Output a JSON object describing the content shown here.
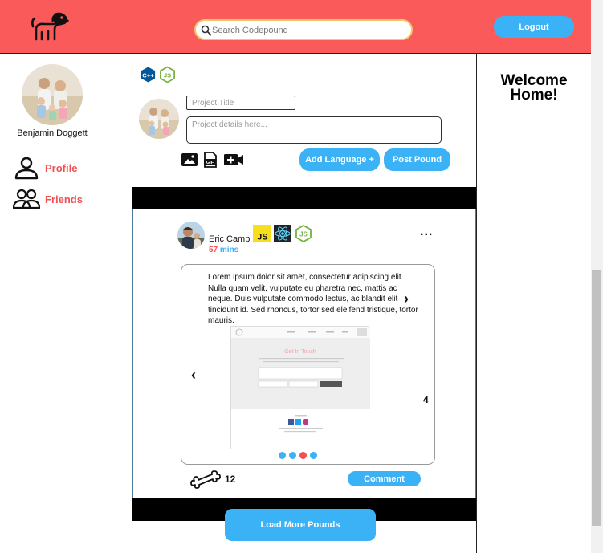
{
  "header": {
    "search_placeholder": "Search Codepound",
    "logout_label": "Logout"
  },
  "sidebar": {
    "user_name": "Benjamin Doggett",
    "items": [
      {
        "label": "Profile",
        "icon": "person-icon"
      },
      {
        "label": "Friends",
        "icon": "people-icon"
      }
    ]
  },
  "composer": {
    "languages": [
      "C++",
      "JS"
    ],
    "title_placeholder": "Project Title",
    "details_placeholder": "Project details here...",
    "media_icons": [
      "image-icon",
      "gif-icon",
      "video-plus-icon"
    ],
    "add_language_label": "Add Language +",
    "post_label": "Post Pound"
  },
  "post": {
    "author": "Eric Camp",
    "time_value": "57",
    "time_unit": "mins",
    "languages": [
      "JS",
      "React",
      "Node"
    ],
    "more_label": "...",
    "text": "Lorem ipsum dolor sit amet, consectetur adipiscing elit. Nulla quam velit, vulputate eu pharetra nec, mattis ac neque. Duis vulputate commodo lectus, ac blandit elit tincidunt id. Sed rhoncus, tortor sed eleifend tristique, tortor mauris.",
    "slide_count": "4",
    "screenshot_heading": "Get In Touch",
    "carousel_active_index": 2,
    "bone_count": "12",
    "comment_label": "Comment"
  },
  "feed": {
    "load_more_label": "Load More Pounds"
  },
  "right": {
    "welcome": "Welcome Home!"
  },
  "colors": {
    "header": "#fa5a5a",
    "accent_blue": "#3bb2f5",
    "accent_red": "#f05252",
    "search_border": "#f5c76a"
  }
}
